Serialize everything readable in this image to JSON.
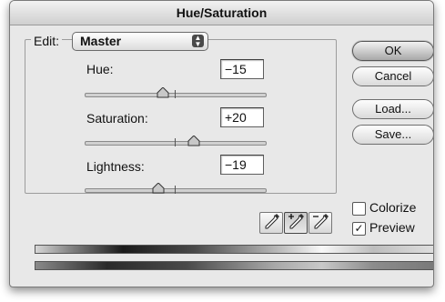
{
  "window": {
    "title": "Hue/Saturation"
  },
  "edit": {
    "label": "Edit:",
    "selected": "Master",
    "arrows_glyph": "▲▼"
  },
  "hue": {
    "label": "Hue:",
    "value": "−15"
  },
  "saturation": {
    "label": "Saturation:",
    "value": "+20"
  },
  "lightness": {
    "label": "Lightness:",
    "value": "−19"
  },
  "buttons": {
    "ok": "OK",
    "cancel": "Cancel",
    "load": "Load...",
    "save": "Save..."
  },
  "colorize": {
    "label": "Colorize",
    "checked": false
  },
  "preview": {
    "label": "Preview",
    "checked": true,
    "mark": "✓"
  },
  "eyedroppers": [
    "eyedropper-icon",
    "eyedropper-plus-icon",
    "eyedropper-minus-icon"
  ],
  "colors": {
    "window_bg": "#e8e8e8",
    "ramp_dark": "#1a1a1a",
    "ramp_light": "#f0f0f0"
  }
}
